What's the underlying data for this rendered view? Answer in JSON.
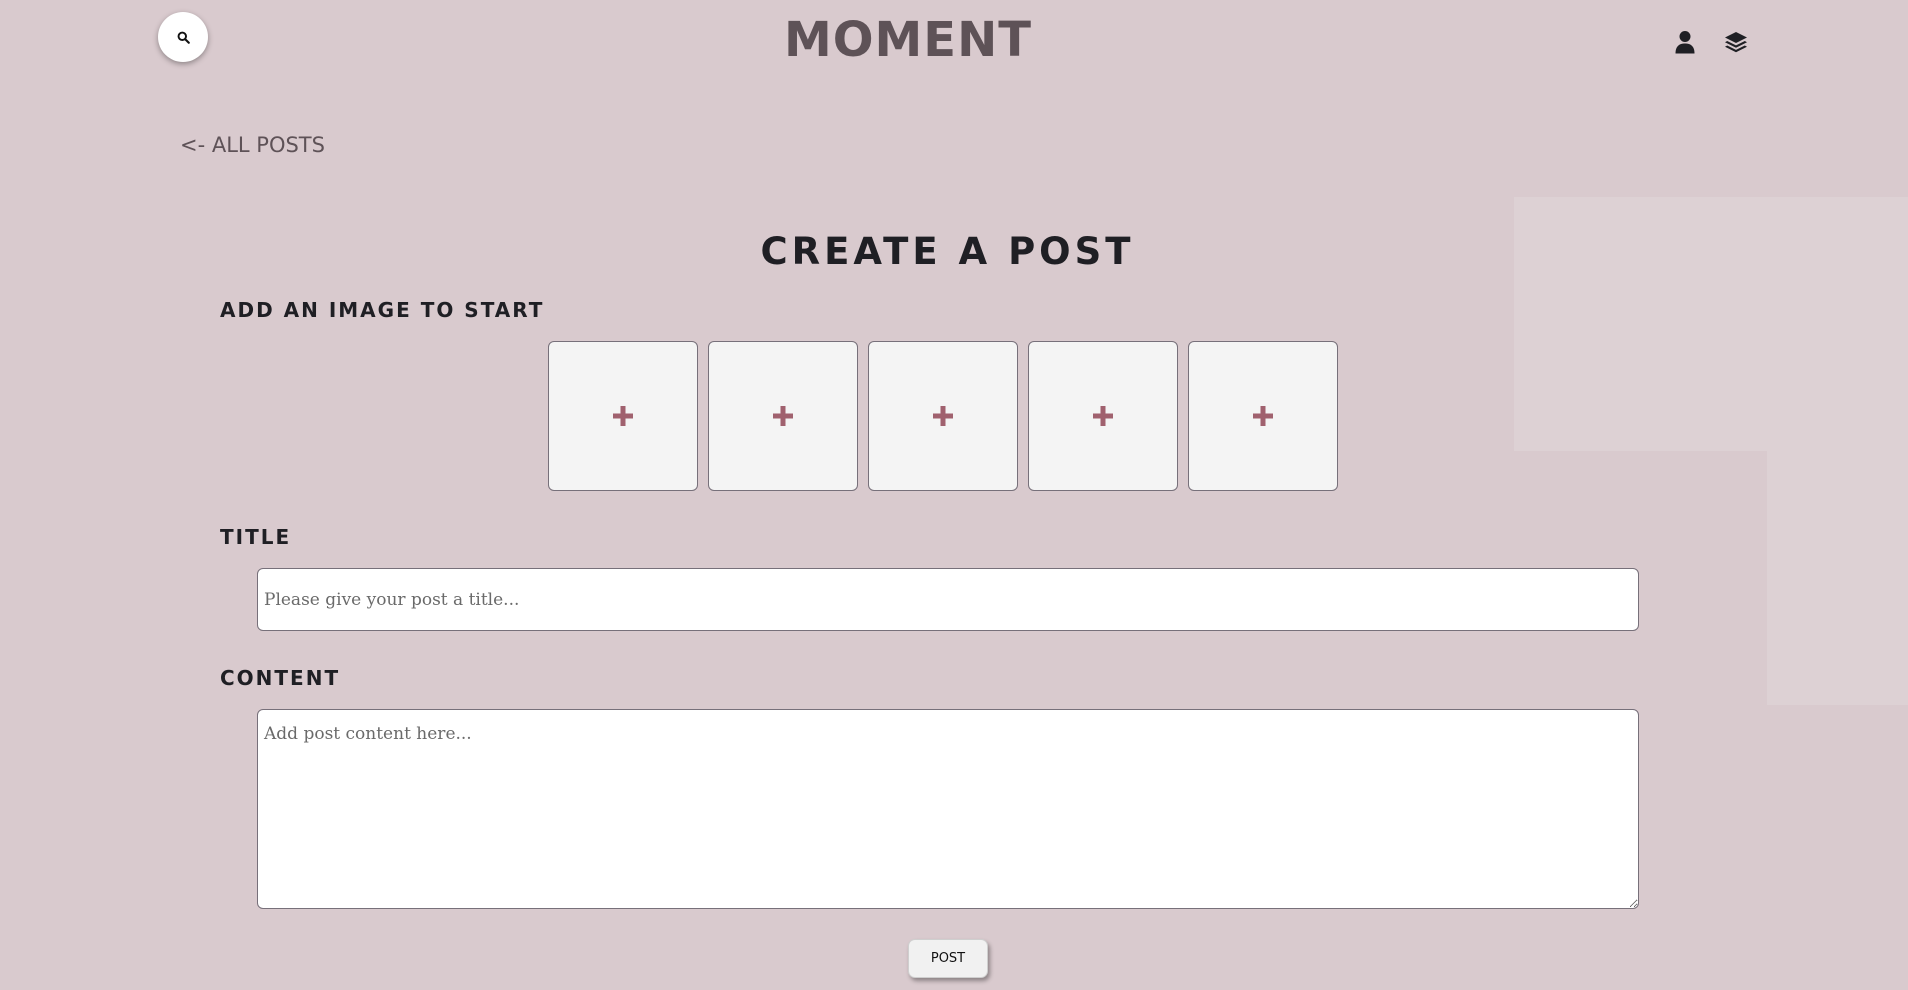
{
  "header": {
    "logo": "MOMENT",
    "search_icon": "search-icon",
    "user_icon": "user-icon",
    "layers_icon": "layers-icon"
  },
  "nav": {
    "back_link": "<- ALL POSTS"
  },
  "form": {
    "page_title": "CREATE A POST",
    "image_section_label": "ADD AN IMAGE TO START",
    "image_slots": [
      {
        "icon": "plus-icon"
      },
      {
        "icon": "plus-icon"
      },
      {
        "icon": "plus-icon"
      },
      {
        "icon": "plus-icon"
      },
      {
        "icon": "plus-icon"
      }
    ],
    "title_label": "TITLE",
    "title_placeholder": "Please give your post a title...",
    "title_value": "",
    "content_label": "CONTENT",
    "content_placeholder": "Add post content here...",
    "content_value": "",
    "submit_label": "POST"
  },
  "colors": {
    "background": "#d9cace",
    "logo": "#5e5257",
    "accent_plus": "#a0616e",
    "text_dark": "#1f1f24"
  }
}
